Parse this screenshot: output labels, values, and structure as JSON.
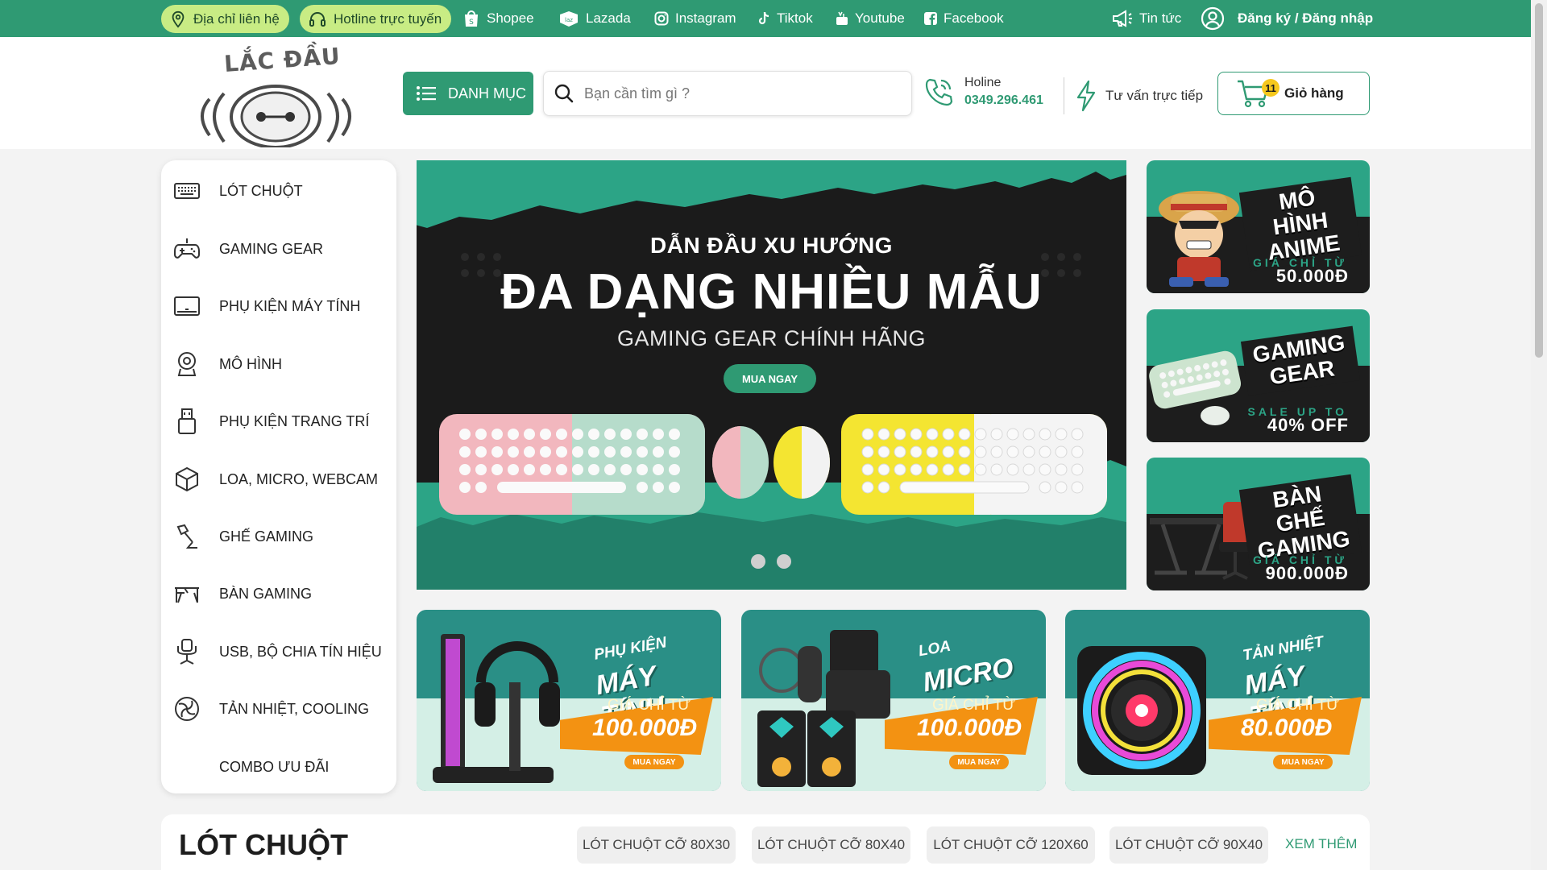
{
  "topbar": {
    "address": "Địa chỉ liên hệ",
    "hotline_online": "Hotline trực tuyến",
    "socials": [
      "Shopee",
      "Lazada",
      "Instagram",
      "Tiktok",
      "Youtube",
      "Facebook"
    ],
    "news": "Tin tức",
    "auth": "Đăng ký / Đăng nhập"
  },
  "header": {
    "logo_text": "LẮC ĐẦU",
    "category_button": "DANH MỤC",
    "search_placeholder": "Bạn cần tìm gì ?",
    "hotline_label": "Holine",
    "hotline_number": "0349.296.461",
    "consult": "Tư vấn trực tiếp",
    "cart_label": "Giỏ hàng",
    "cart_count": "11"
  },
  "sidebar": {
    "items": [
      {
        "label": "LÓT CHUỘT",
        "icon": "keyboard-icon"
      },
      {
        "label": "GAMING GEAR",
        "icon": "gamepad-icon"
      },
      {
        "label": "PHỤ KIỆN MÁY TÍNH",
        "icon": "monitor-icon"
      },
      {
        "label": "MÔ HÌNH",
        "icon": "figure-icon"
      },
      {
        "label": "PHỤ KIỆN TRANG TRÍ",
        "icon": "usb-drive-icon"
      },
      {
        "label": "LOA, MICRO, WEBCAM",
        "icon": "box-icon"
      },
      {
        "label": "GHẾ GAMING",
        "icon": "lamp-icon"
      },
      {
        "label": "BÀN GAMING",
        "icon": "desk-icon"
      },
      {
        "label": "USB, BỘ CHIA TÍN HIỆU",
        "icon": "chair-icon"
      },
      {
        "label": "TẢN NHIỆT, COOLING",
        "icon": "fan-icon"
      },
      {
        "label": "COMBO ƯU ĐÃI",
        "icon": ""
      }
    ]
  },
  "banner": {
    "subtitle": "DẪN ĐẦU XU HƯỚNG",
    "title": "ĐA DẠNG NHIỀU MẪU",
    "tagline": "GAMING GEAR CHÍNH HÃNG",
    "button": "MUA NGAY",
    "slides": 2
  },
  "promos": [
    {
      "title": "MÔ HÌNH ANIME",
      "small": "GIÁ CHỈ TỪ",
      "value": "50.000Đ"
    },
    {
      "title": "GAMING GEAR",
      "small": "SALE UP TO",
      "value": "40% OFF"
    },
    {
      "title": "BÀN GHẾ GAMING",
      "small": "GIÁ CHỈ TỪ",
      "value": "900.000Đ"
    }
  ],
  "bottom_banners": [
    {
      "line1": "PHỤ KIỆN",
      "line2": "MÁY TÍNH",
      "from": "GIÁ CHỈ TỪ",
      "price": "100.000Đ",
      "cta": "MUA NGAY"
    },
    {
      "line1": "LOA",
      "line2": "MICRO",
      "from": "GIÁ CHỈ TỪ",
      "price": "100.000Đ",
      "cta": "MUA NGAY"
    },
    {
      "line1": "TẢN NHIỆT",
      "line2": "MÁY TÍNH",
      "from": "GIÁ CHỈ TỪ",
      "price": "80.000Đ",
      "cta": "MUA NGAY"
    }
  ],
  "section": {
    "title": "LÓT CHUỘT",
    "chips": [
      "LÓT CHUỘT CỠ 80X30",
      "LÓT CHUỘT CỠ 80X40",
      "LÓT CHUỘT CỠ 120X60",
      "LÓT CHUỘT CỠ 90X40"
    ],
    "more": "XEM THÊM"
  },
  "colors": {
    "brand_green": "#2f9a73",
    "pill_lime": "#c8ec84",
    "orange": "#f39212",
    "teal": "#2ca486"
  }
}
